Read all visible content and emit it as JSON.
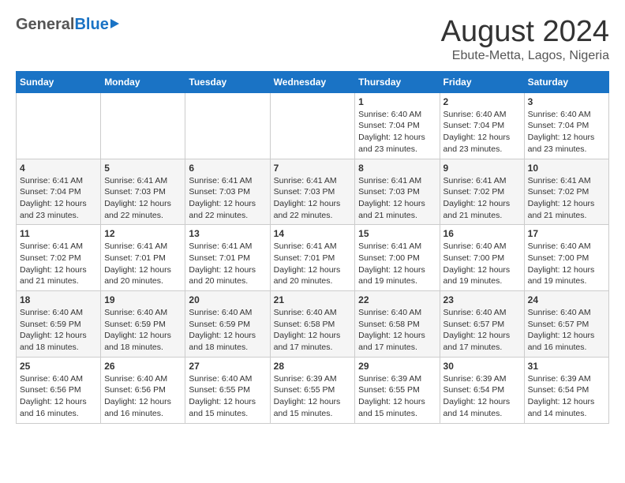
{
  "header": {
    "logo": {
      "general": "General",
      "blue": "Blue",
      "arrow": "▶"
    },
    "title": "August 2024",
    "subtitle": "Ebute-Metta, Lagos, Nigeria"
  },
  "calendar": {
    "days_of_week": [
      "Sunday",
      "Monday",
      "Tuesday",
      "Wednesday",
      "Thursday",
      "Friday",
      "Saturday"
    ],
    "weeks": [
      [
        {
          "day": "",
          "info": ""
        },
        {
          "day": "",
          "info": ""
        },
        {
          "day": "",
          "info": ""
        },
        {
          "day": "",
          "info": ""
        },
        {
          "day": "1",
          "info": "Sunrise: 6:40 AM\nSunset: 7:04 PM\nDaylight: 12 hours\nand 23 minutes."
        },
        {
          "day": "2",
          "info": "Sunrise: 6:40 AM\nSunset: 7:04 PM\nDaylight: 12 hours\nand 23 minutes."
        },
        {
          "day": "3",
          "info": "Sunrise: 6:40 AM\nSunset: 7:04 PM\nDaylight: 12 hours\nand 23 minutes."
        }
      ],
      [
        {
          "day": "4",
          "info": "Sunrise: 6:41 AM\nSunset: 7:04 PM\nDaylight: 12 hours\nand 23 minutes."
        },
        {
          "day": "5",
          "info": "Sunrise: 6:41 AM\nSunset: 7:03 PM\nDaylight: 12 hours\nand 22 minutes."
        },
        {
          "day": "6",
          "info": "Sunrise: 6:41 AM\nSunset: 7:03 PM\nDaylight: 12 hours\nand 22 minutes."
        },
        {
          "day": "7",
          "info": "Sunrise: 6:41 AM\nSunset: 7:03 PM\nDaylight: 12 hours\nand 22 minutes."
        },
        {
          "day": "8",
          "info": "Sunrise: 6:41 AM\nSunset: 7:03 PM\nDaylight: 12 hours\nand 21 minutes."
        },
        {
          "day": "9",
          "info": "Sunrise: 6:41 AM\nSunset: 7:02 PM\nDaylight: 12 hours\nand 21 minutes."
        },
        {
          "day": "10",
          "info": "Sunrise: 6:41 AM\nSunset: 7:02 PM\nDaylight: 12 hours\nand 21 minutes."
        }
      ],
      [
        {
          "day": "11",
          "info": "Sunrise: 6:41 AM\nSunset: 7:02 PM\nDaylight: 12 hours\nand 21 minutes."
        },
        {
          "day": "12",
          "info": "Sunrise: 6:41 AM\nSunset: 7:01 PM\nDaylight: 12 hours\nand 20 minutes."
        },
        {
          "day": "13",
          "info": "Sunrise: 6:41 AM\nSunset: 7:01 PM\nDaylight: 12 hours\nand 20 minutes."
        },
        {
          "day": "14",
          "info": "Sunrise: 6:41 AM\nSunset: 7:01 PM\nDaylight: 12 hours\nand 20 minutes."
        },
        {
          "day": "15",
          "info": "Sunrise: 6:41 AM\nSunset: 7:00 PM\nDaylight: 12 hours\nand 19 minutes."
        },
        {
          "day": "16",
          "info": "Sunrise: 6:40 AM\nSunset: 7:00 PM\nDaylight: 12 hours\nand 19 minutes."
        },
        {
          "day": "17",
          "info": "Sunrise: 6:40 AM\nSunset: 7:00 PM\nDaylight: 12 hours\nand 19 minutes."
        }
      ],
      [
        {
          "day": "18",
          "info": "Sunrise: 6:40 AM\nSunset: 6:59 PM\nDaylight: 12 hours\nand 18 minutes."
        },
        {
          "day": "19",
          "info": "Sunrise: 6:40 AM\nSunset: 6:59 PM\nDaylight: 12 hours\nand 18 minutes."
        },
        {
          "day": "20",
          "info": "Sunrise: 6:40 AM\nSunset: 6:59 PM\nDaylight: 12 hours\nand 18 minutes."
        },
        {
          "day": "21",
          "info": "Sunrise: 6:40 AM\nSunset: 6:58 PM\nDaylight: 12 hours\nand 17 minutes."
        },
        {
          "day": "22",
          "info": "Sunrise: 6:40 AM\nSunset: 6:58 PM\nDaylight: 12 hours\nand 17 minutes."
        },
        {
          "day": "23",
          "info": "Sunrise: 6:40 AM\nSunset: 6:57 PM\nDaylight: 12 hours\nand 17 minutes."
        },
        {
          "day": "24",
          "info": "Sunrise: 6:40 AM\nSunset: 6:57 PM\nDaylight: 12 hours\nand 16 minutes."
        }
      ],
      [
        {
          "day": "25",
          "info": "Sunrise: 6:40 AM\nSunset: 6:56 PM\nDaylight: 12 hours\nand 16 minutes."
        },
        {
          "day": "26",
          "info": "Sunrise: 6:40 AM\nSunset: 6:56 PM\nDaylight: 12 hours\nand 16 minutes."
        },
        {
          "day": "27",
          "info": "Sunrise: 6:40 AM\nSunset: 6:55 PM\nDaylight: 12 hours\nand 15 minutes."
        },
        {
          "day": "28",
          "info": "Sunrise: 6:39 AM\nSunset: 6:55 PM\nDaylight: 12 hours\nand 15 minutes."
        },
        {
          "day": "29",
          "info": "Sunrise: 6:39 AM\nSunset: 6:55 PM\nDaylight: 12 hours\nand 15 minutes."
        },
        {
          "day": "30",
          "info": "Sunrise: 6:39 AM\nSunset: 6:54 PM\nDaylight: 12 hours\nand 14 minutes."
        },
        {
          "day": "31",
          "info": "Sunrise: 6:39 AM\nSunset: 6:54 PM\nDaylight: 12 hours\nand 14 minutes."
        }
      ]
    ]
  }
}
